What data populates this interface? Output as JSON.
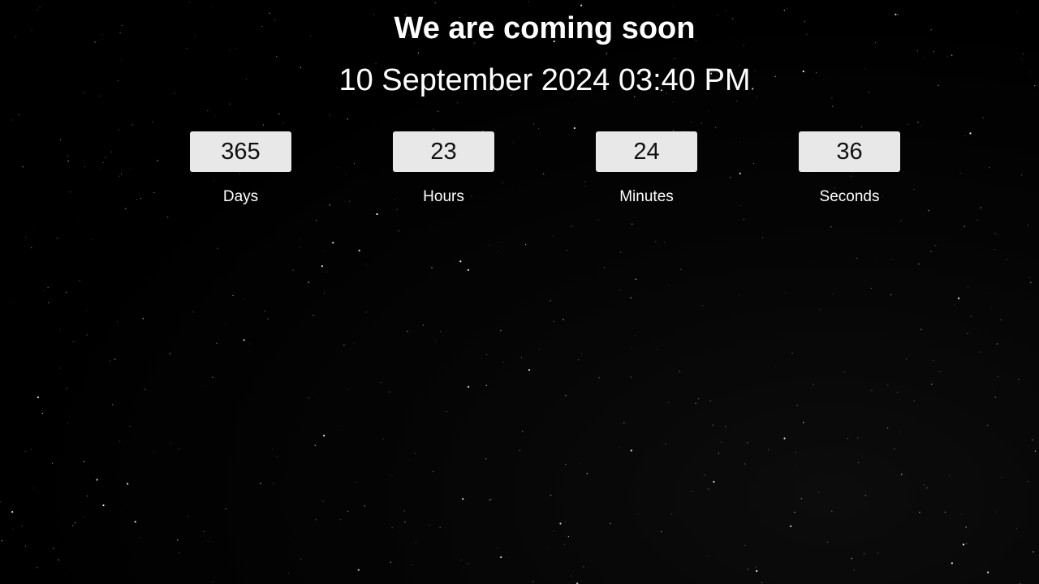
{
  "page": {
    "title": "We are coming soon",
    "launch_date": "10 September 2024 03:40 PM"
  },
  "countdown": {
    "days": {
      "value": "365",
      "label": "Days"
    },
    "hours": {
      "value": "23",
      "label": "Hours"
    },
    "minutes": {
      "value": "24",
      "label": "Minutes"
    },
    "seconds": {
      "value": "36",
      "label": "Seconds"
    }
  },
  "theme": {
    "background": "#000000",
    "text": "#ffffff",
    "box_background": "#e8e8e8",
    "box_text": "#111111"
  }
}
